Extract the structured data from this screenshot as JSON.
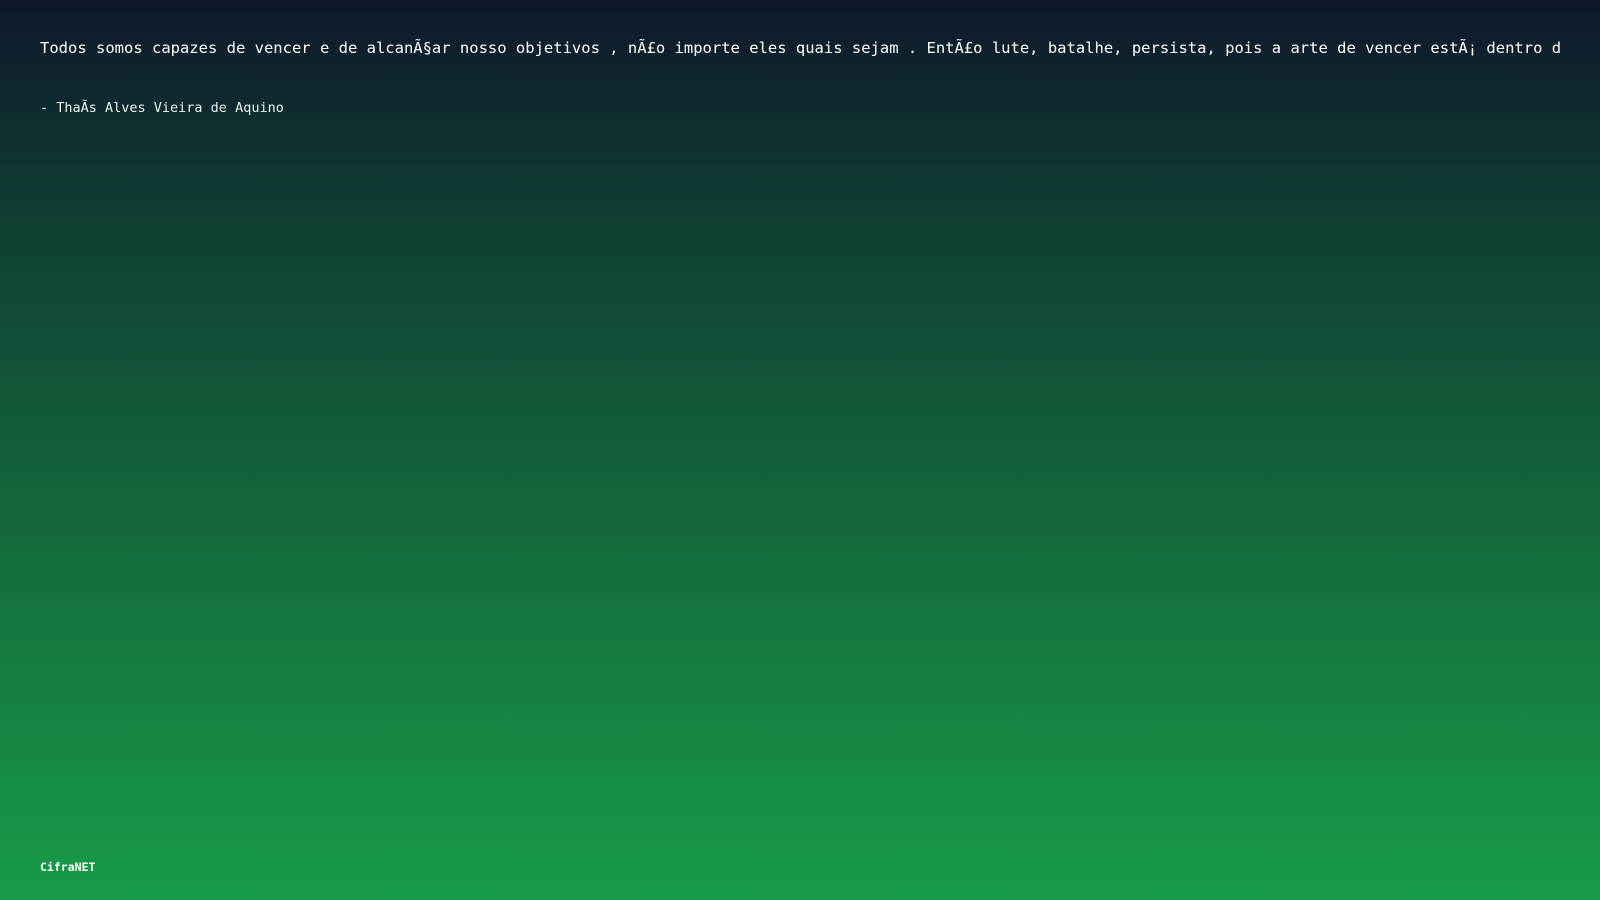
{
  "quote": {
    "text": "Todos somos capazes de vencer e de alcanÃ§ar nosso objetivos , nÃ£o importe eles quais sejam . EntÃ£o lute, batalhe, persista, pois a arte de vencer estÃ¡ dentro de...",
    "author": "- ThaÃ­s Alves Vieira de Aquino"
  },
  "footer": {
    "brand": "CifraNET"
  },
  "colors": {
    "gradient_top": "#0f172a",
    "gradient_bottom": "#169c48",
    "text": "#ffffff"
  }
}
